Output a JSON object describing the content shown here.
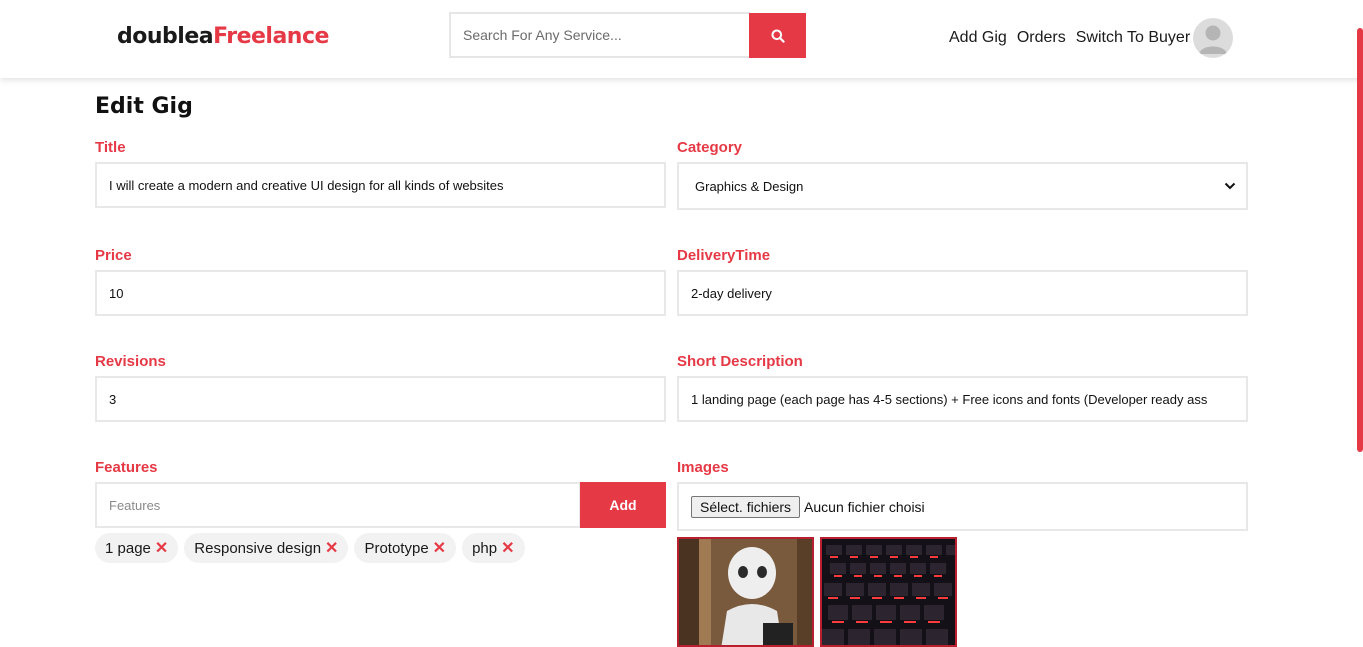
{
  "header": {
    "logo_main": "doublea",
    "logo_accent": "Freelance",
    "search_placeholder": "Search For Any Service...",
    "nav": [
      "Add Gig",
      "Orders",
      "Switch To Buyer"
    ]
  },
  "page_title": "Edit Gig",
  "form": {
    "title_label": "Title",
    "title_value": "I will create a modern and creative UI design for all kinds of websites",
    "category_label": "Category",
    "category_value": "Graphics & Design",
    "price_label": "Price",
    "price_value": "10",
    "delivery_label": "DeliveryTime",
    "delivery_value": "2-day delivery",
    "revisions_label": "Revisions",
    "revisions_value": "3",
    "short_desc_label": "Short Description",
    "short_desc_value": "1 landing page (each page has 4-5 sections) + Free icons and fonts (Developer ready ass",
    "features_label": "Features",
    "features_placeholder": "Features",
    "add_label": "Add",
    "features": [
      "1 page",
      "Responsive design",
      "Prototype",
      "php"
    ],
    "images_label": "Images",
    "file_button_label": "Sélect. fichiers",
    "file_status": "Aucun fichier choisi",
    "remove_symbol": "✕"
  },
  "colors": {
    "accent": "#e63946",
    "field_border": "#e8e8e8"
  }
}
